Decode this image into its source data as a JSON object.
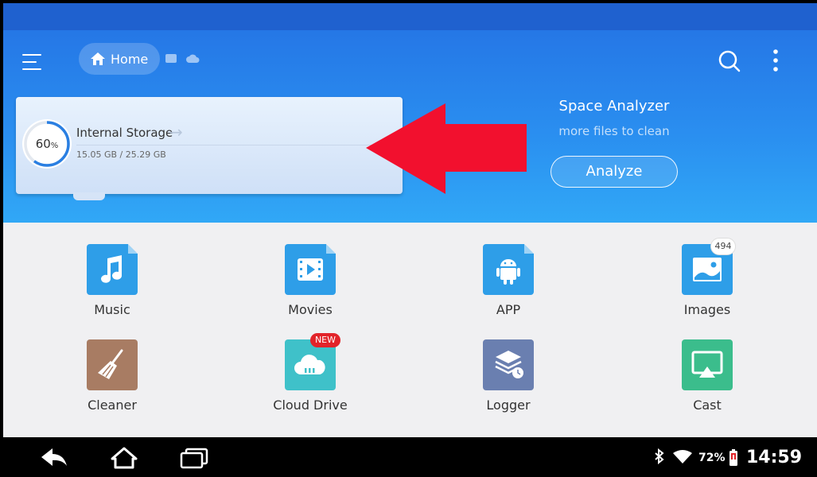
{
  "header": {
    "home_label": "Home"
  },
  "storage": {
    "name": "Internal Storage",
    "percent_value": "60",
    "percent_unit": "%",
    "used_fraction": 0.6,
    "size_text": "15.05 GB / 25.29 GB"
  },
  "space_analyzer": {
    "title": "Space Analyzer",
    "subtitle": "more files to clean",
    "button_label": "Analyze"
  },
  "tiles": [
    {
      "label": "Music",
      "icon": "music-note-icon",
      "color": "#2e9ee8"
    },
    {
      "label": "Movies",
      "icon": "play-film-icon",
      "color": "#2e9ee8"
    },
    {
      "label": "APP",
      "icon": "android-icon",
      "color": "#2e9ee8"
    },
    {
      "label": "Images",
      "icon": "image-icon",
      "color": "#2e9ee8",
      "badge": "494"
    },
    {
      "label": "Cleaner",
      "icon": "broom-icon",
      "color": "#a87c63"
    },
    {
      "label": "Cloud Drive",
      "icon": "cloud-icon",
      "color": "#3fc1c9",
      "badge": "NEW"
    },
    {
      "label": "Logger",
      "icon": "layers-clock-icon",
      "color": "#6a7fb0"
    },
    {
      "label": "Cast",
      "icon": "cast-screen-icon",
      "color": "#3bbd8c"
    }
  ],
  "status_bar": {
    "battery": "72%",
    "time": "14:59"
  },
  "colors": {
    "header_top": "#2577e6",
    "header_bottom": "#31a8f6",
    "annotation_arrow": "#f2102e",
    "grid_bg": "#f0f0f2"
  }
}
